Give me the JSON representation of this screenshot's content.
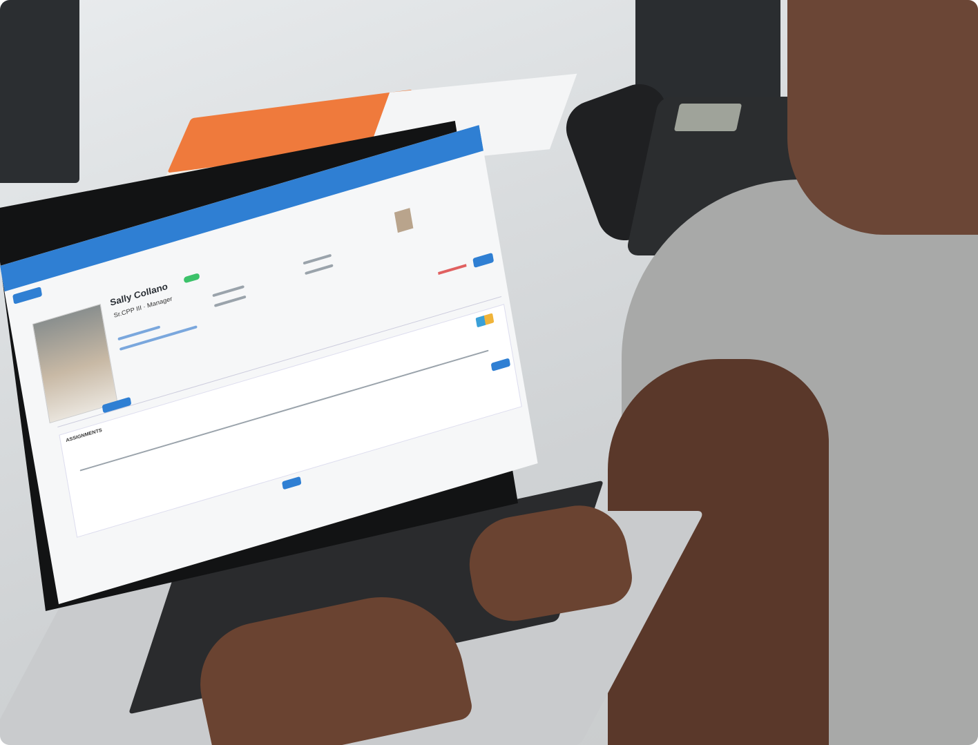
{
  "profile": {
    "name": "Sally Collano",
    "role_line": "Sr.CPP III · Manager"
  },
  "sections": {
    "assignments": "ASSIGNMENTS"
  },
  "colors": {
    "accent": "#2f7fd3",
    "notebook": "#ef7a3c",
    "status_badge": "#3cc26a"
  },
  "icons": [
    "photo-laptop",
    "phone-icon",
    "notebook-icon"
  ]
}
